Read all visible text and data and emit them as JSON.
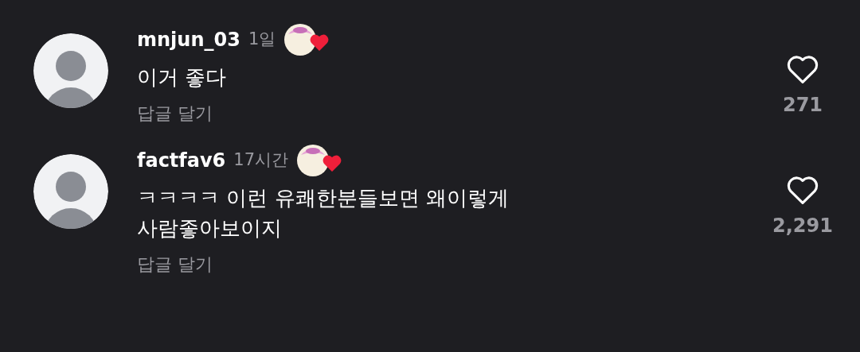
{
  "comments": [
    {
      "username": "mnjun_03",
      "time": "1일",
      "creator_liked": true,
      "text": [
        "이거 좋다"
      ],
      "reply": "답글 달기",
      "likes": "271",
      "liked": false
    },
    {
      "username": "factfav6",
      "time": "17시간",
      "creator_liked": true,
      "text": [
        "ㅋㅋㅋㅋ 이런 유쾌한분들보면 왜이렇게",
        "사람좋아보이지"
      ],
      "reply": "답글 달기",
      "likes": "2,291",
      "liked": false
    }
  ]
}
